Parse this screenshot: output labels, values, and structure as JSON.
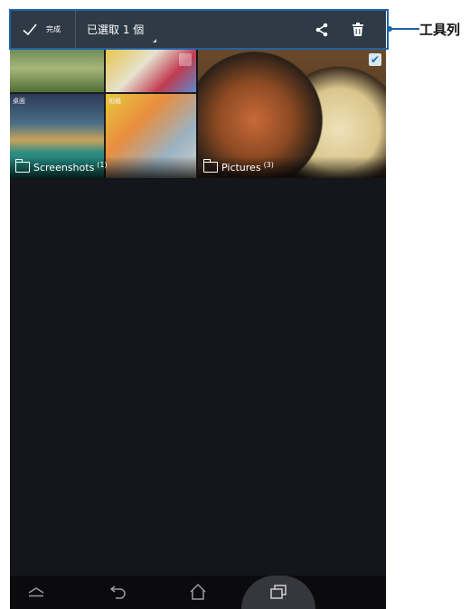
{
  "action_bar": {
    "done_label": "完成",
    "selected_text": "已選取 1 個",
    "icons": [
      "check-icon",
      "share-icon",
      "trash-icon"
    ]
  },
  "albums": [
    {
      "name": "Screenshots",
      "count": "(1)",
      "selected": false,
      "thumb_captions": [
        "桌面",
        "相機"
      ]
    },
    {
      "name": "Pictures",
      "count": "(3)",
      "selected": true
    }
  ],
  "nav_bar": {
    "icons": [
      "back-chevron-icon",
      "return-arrow-icon",
      "home-icon",
      "recent-apps-icon"
    ]
  },
  "annotation": {
    "label": "工具列",
    "color": "#1f63a8"
  },
  "colors": {
    "action_bar": "#2e3a46",
    "screen_bg": "#15151c",
    "nav_bar": "#0b0b0e",
    "check_accent": "#1f6fb0"
  }
}
